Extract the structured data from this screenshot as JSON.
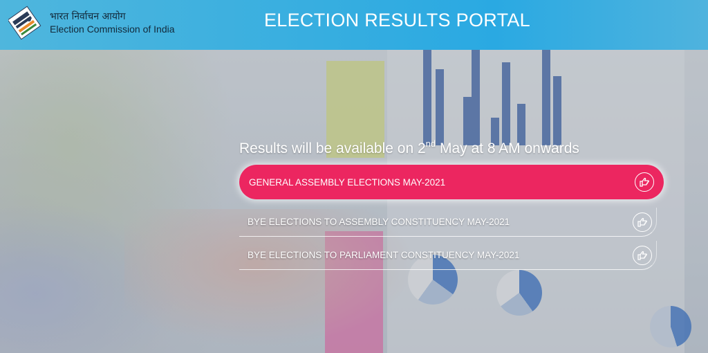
{
  "header": {
    "logo_hindi": "भारत निर्वाचन आयोग",
    "logo_english": "Election Commission of India",
    "title": "ELECTION RESULTS PORTAL"
  },
  "main": {
    "headline_prefix": "Results will be available on 2",
    "headline_sup": "nd",
    "headline_suffix": " May at 8 AM onwards",
    "links": [
      {
        "label": "GENERAL ASSEMBLY ELECTIONS MAY-2021",
        "icon": "pointing-hand-icon"
      },
      {
        "label": "BYE ELECTIONS TO ASSEMBLY CONSTITUENCY MAY-2021",
        "icon": "pointing-hand-icon"
      },
      {
        "label": "BYE ELECTIONS TO PARLIAMENT CONSTITUENCY MAY-2021",
        "icon": "pointing-hand-icon"
      }
    ]
  },
  "colors": {
    "header_blue": "#37aee0",
    "primary_button": "#ec2660",
    "text_white": "#ffffff"
  }
}
